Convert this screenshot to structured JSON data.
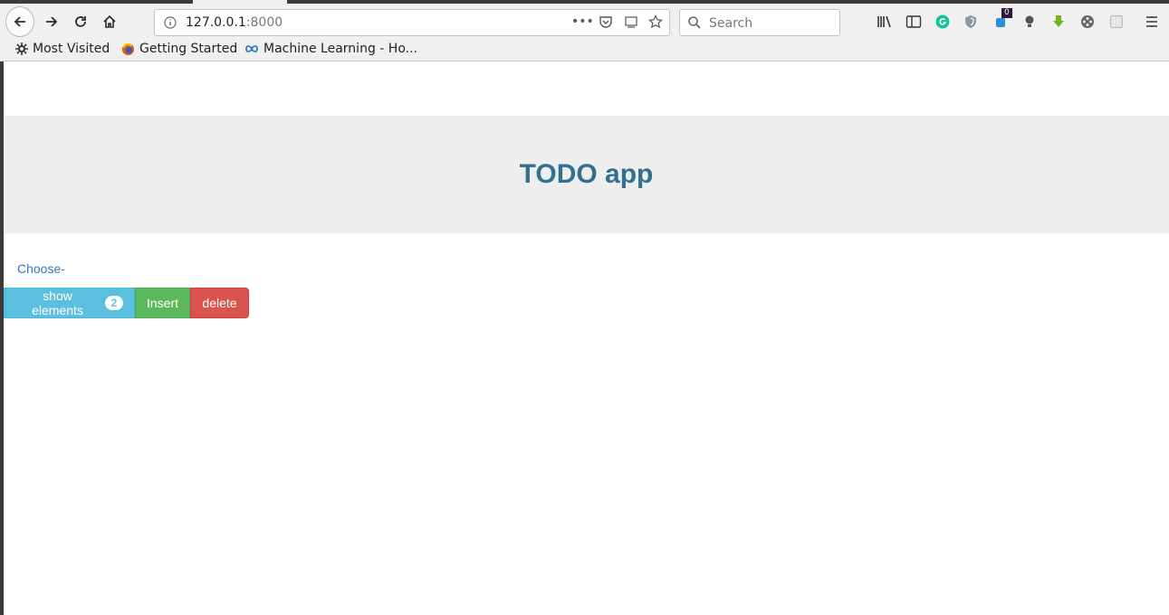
{
  "browser": {
    "url_host": "127.0.0.1",
    "url_port": ":8000",
    "search_placeholder": "Search",
    "extension_badge": "0"
  },
  "bookmarks": [
    {
      "label": "Most Visited",
      "icon": "gear-icon"
    },
    {
      "label": "Getting Started",
      "icon": "firefox-icon"
    },
    {
      "label": "Machine Learning - Ho...",
      "icon": "infinity-icon"
    }
  ],
  "app": {
    "title": "TODO app",
    "choose_label": "Choose-",
    "buttons": {
      "show_elements": "show elements",
      "show_elements_count": "2",
      "insert": "Insert",
      "delete": "delete"
    }
  },
  "colors": {
    "title": "#31708f",
    "info": "#5bc0de",
    "success": "#5cb85c",
    "danger": "#d9534f"
  }
}
